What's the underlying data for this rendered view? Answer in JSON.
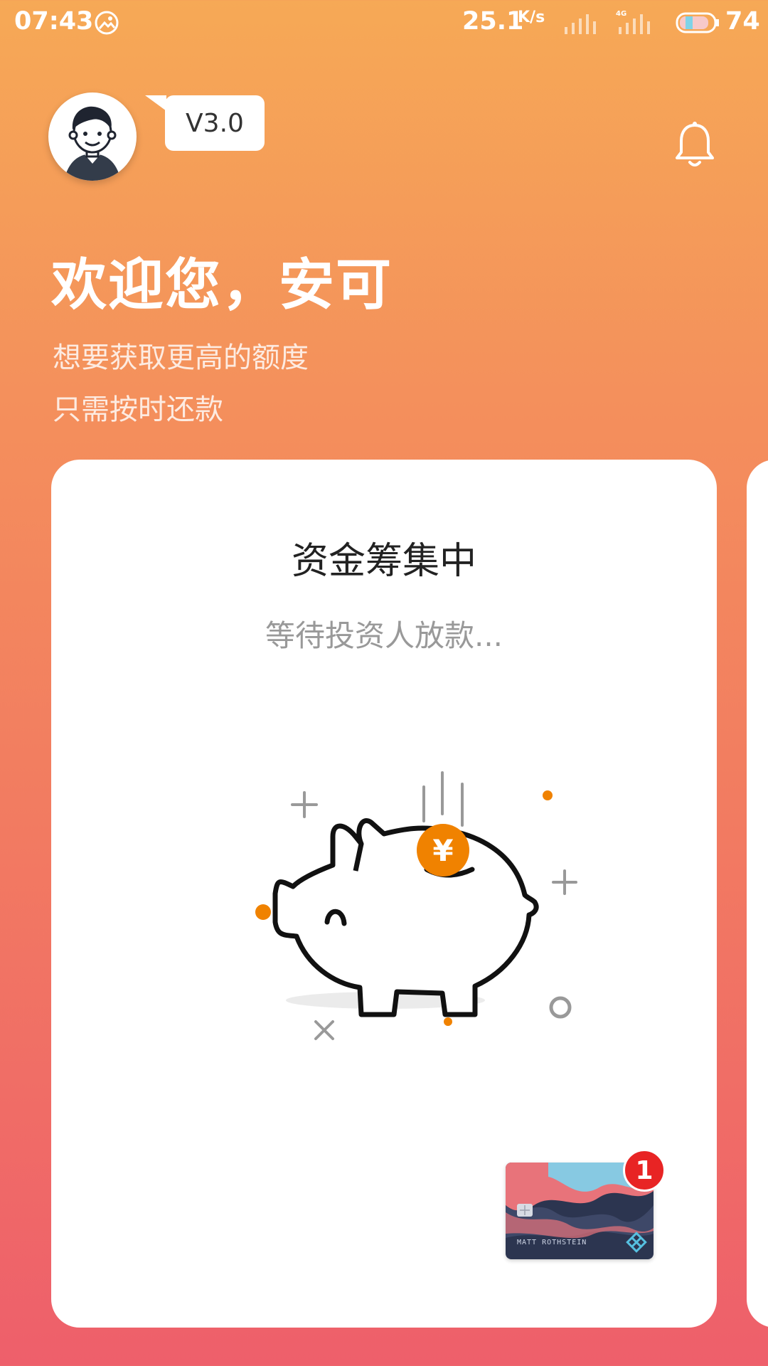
{
  "status_bar": {
    "time": "07:43",
    "speed": "25.1",
    "speed_unit": "K/s",
    "network": "4G",
    "battery": "74"
  },
  "header": {
    "version": "V3.0",
    "welcome": "欢迎您，安可",
    "subtitle_line1": "想要获取更高的额度",
    "subtitle_line2": "只需按时还款"
  },
  "card": {
    "title": "资金筹集中",
    "subtitle": "等待投资人放款...",
    "coin_symbol": "¥",
    "bank_card_name": "MATT ROTHSTEIN",
    "badge_count": "1"
  },
  "colors": {
    "gradient_top": "#f6a956",
    "gradient_bottom": "#ee5f6b",
    "accent_orange": "#f08200",
    "badge_red": "#e82424"
  },
  "icons": [
    "photo-icon",
    "signal-icon",
    "battery-icon",
    "avatar-icon",
    "bell-icon",
    "piggy-bank-icon",
    "coin-icon",
    "bank-card-icon"
  ]
}
